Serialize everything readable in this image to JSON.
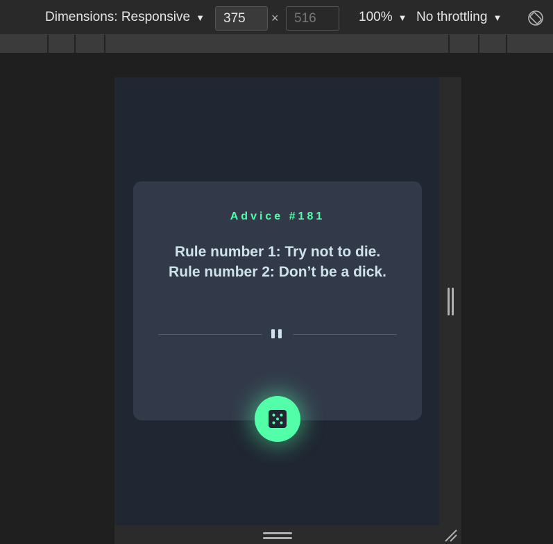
{
  "devtools": {
    "dimensions_label": "Dimensions: Responsive",
    "width_value": "375",
    "height_placeholder": "516",
    "times": "×",
    "zoom": "100%",
    "throttling": "No throttling",
    "caret": "▼"
  },
  "advice": {
    "id_label": "Advice #181",
    "text": "Rule number 1: Try not to die. Rule number 2: Don’t be a dick."
  },
  "colors": {
    "accent": "#52ffa8",
    "card": "#323a4a",
    "background": "#202632",
    "text": "#cee3e9"
  },
  "icons": {
    "dice": "dice-icon",
    "pause": "pause-divider-icon",
    "rotate": "rotate-icon"
  }
}
